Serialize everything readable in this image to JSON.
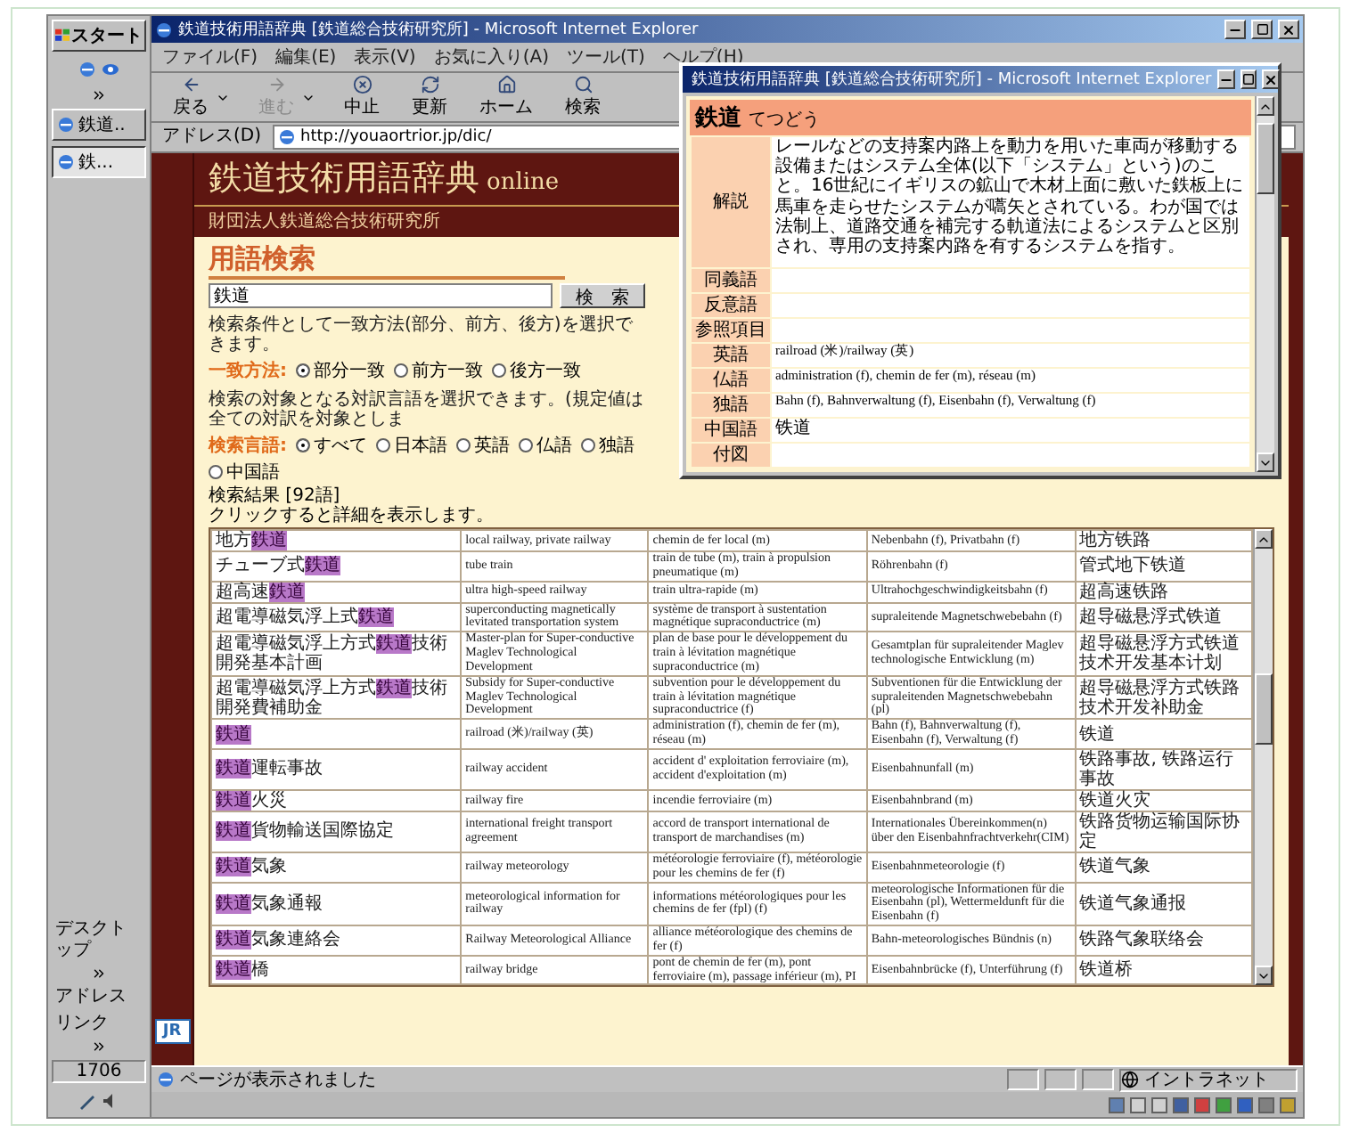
{
  "taskbar_left": {
    "start": "スタート",
    "buttons": [
      {
        "label": "鉄道..",
        "selected": false
      },
      {
        "label": "鉄...",
        "selected": true
      }
    ],
    "toolbars": [
      "デスクトップ",
      "アドレス",
      "リンク"
    ],
    "clock": "1706"
  },
  "window": {
    "title": "鉄道技術用語辞典 [鉄道総合技術研究所] - Microsoft Internet Explorer"
  },
  "menu": [
    "ファイル(F)",
    "編集(E)",
    "表示(V)",
    "お気に入り(A)",
    "ツール(T)",
    "ヘルプ(H)"
  ],
  "toolbar": [
    {
      "label": "戻る",
      "disabled": false,
      "dropdown": true
    },
    {
      "label": "進む",
      "disabled": true,
      "dropdown": true
    },
    {
      "label": "中止",
      "disabled": false,
      "dropdown": false
    },
    {
      "label": "更新",
      "disabled": false,
      "dropdown": false
    },
    {
      "label": "ホーム",
      "disabled": false,
      "dropdown": false
    },
    {
      "label": "検索",
      "disabled": false,
      "dropdown": false
    }
  ],
  "address": {
    "label": "アドレス(D)",
    "url": "http://youaortrior.jp/dic/"
  },
  "page": {
    "title": "鉄道技術用語辞典",
    "title_suffix": "online",
    "org": "財団法人鉄道総合技術研究所",
    "logo": "JR",
    "heading": "用語検索",
    "search": {
      "value": "鉄道",
      "button": "検　索"
    },
    "filters": [
      {
        "note": "検索条件として一致方法(部分、前方、後方)を選択できます。",
        "label": "一致方法:",
        "options": [
          {
            "label": "部分一致",
            "selected": true
          },
          {
            "label": "前方一致",
            "selected": false
          },
          {
            "label": "後方一致",
            "selected": false
          }
        ]
      },
      {
        "note": "検索の対象となる対訳言語を選択できます。(規定値は全ての対訳を対象としま",
        "label": "検索言語:",
        "options": [
          {
            "label": "すべて",
            "selected": true
          },
          {
            "label": "日本語",
            "selected": false
          },
          {
            "label": "英語",
            "selected": false
          },
          {
            "label": "仏語",
            "selected": false
          },
          {
            "label": "独語",
            "selected": false
          },
          {
            "label": "中国語",
            "selected": false
          }
        ]
      }
    ],
    "results": {
      "count": "検索結果 [92語]",
      "hint": "クリックすると詳細を表示します。",
      "rows": [
        {
          "term": [
            {
              "text": "地方",
              "hit": false
            },
            {
              "text": "鉄道",
              "hit": true
            }
          ],
          "en": "local railway, private railway",
          "fr": "chemin de fer local (m)",
          "de": "Nebenbahn (f), Privatbahn (f)",
          "zh": "地方铁路"
        },
        {
          "term": [
            {
              "text": "チューブ式",
              "hit": false
            },
            {
              "text": "鉄道",
              "hit": true
            }
          ],
          "en": "tube train",
          "fr": "train de tube (m), train à propulsion pneumatique (m)",
          "de": "Röhrenbahn (f)",
          "zh": "管式地下铁道"
        },
        {
          "term": [
            {
              "text": "超高速",
              "hit": false
            },
            {
              "text": "鉄道",
              "hit": true
            }
          ],
          "en": "ultra high-speed railway",
          "fr": "train ultra-rapide (m)",
          "de": "Ultrahochgeschwindigkeitsbahn (f)",
          "zh": "超高速铁路"
        },
        {
          "term": [
            {
              "text": "超電導磁気浮上式",
              "hit": false
            },
            {
              "text": "鉄道",
              "hit": true
            }
          ],
          "en": "superconducting magnetically levitated transportation system",
          "fr": "système de transport à sustentation magnétique supraconductrice (m)",
          "de": "supraleitende Magnetschwebebahn (f)",
          "zh": "超导磁悬浮式铁道"
        },
        {
          "term": [
            {
              "text": "超電導磁気浮上方式",
              "hit": false
            },
            {
              "text": "鉄道",
              "hit": true
            },
            {
              "text": "技術開発基本計画",
              "hit": false
            }
          ],
          "en": "Master-plan for Super-conductive Maglev Technological Development",
          "fr": "plan de base pour le développement du train à lévitation magnétique supraconductrice (m)",
          "de": "Gesamtplan für supraleitender Maglev technologische Entwicklung (m)",
          "zh": "超导磁悬浮方式铁道技术开发基本计划"
        },
        {
          "term": [
            {
              "text": "超電導磁気浮上方式",
              "hit": false
            },
            {
              "text": "鉄道",
              "hit": true
            },
            {
              "text": "技術開発費補助金",
              "hit": false
            }
          ],
          "en": "Subsidy for Super-conductive Maglev Technological Development",
          "fr": "subvention pour le développement du train à lévitation magnétique supraconductrice (f)",
          "de": "Subventionen für die Entwicklung der supraleitenden Magnetschwebebahn (pl)",
          "zh": "超导磁悬浮方式铁路技术开发补助金"
        },
        {
          "term": [
            {
              "text": "鉄道",
              "hit": true
            }
          ],
          "en": "railroad (米)/railway (英)",
          "fr": "administration (f), chemin de fer (m), réseau (m)",
          "de": "Bahn (f), Bahnverwaltung (f), Eisenbahn (f), Verwaltung (f)",
          "zh": "铁道"
        },
        {
          "term": [
            {
              "text": "鉄道",
              "hit": true
            },
            {
              "text": "運転事故",
              "hit": false
            }
          ],
          "en": "railway accident",
          "fr": "accident d' exploitation ferroviaire (m), accident d'exploitation (m)",
          "de": "Eisenbahnunfall (m)",
          "zh": "铁路事故, 铁路运行事故"
        },
        {
          "term": [
            {
              "text": "鉄道",
              "hit": true
            },
            {
              "text": "火災",
              "hit": false
            }
          ],
          "en": "railway fire",
          "fr": "incendie ferroviaire (m)",
          "de": "Eisenbahnbrand (m)",
          "zh": "铁道火灾"
        },
        {
          "term": [
            {
              "text": "鉄道",
              "hit": true
            },
            {
              "text": "貨物輸送国際協定",
              "hit": false
            }
          ],
          "en": "international freight transport agreement",
          "fr": "accord de transport international de transport de marchandises (m)",
          "de": "Internationales Übereinkommen(n) über den Eisenbahnfrachtverkehr(CIM)",
          "zh": "铁路货物运输国际协定"
        },
        {
          "term": [
            {
              "text": "鉄道",
              "hit": true
            },
            {
              "text": "気象",
              "hit": false
            }
          ],
          "en": "railway meteorology",
          "fr": "météorologie ferroviaire (f), météorologie pour les chemins de fer (f)",
          "de": "Eisenbahnmeteorologie (f)",
          "zh": "铁道气象"
        },
        {
          "term": [
            {
              "text": "鉄道",
              "hit": true
            },
            {
              "text": "気象通報",
              "hit": false
            }
          ],
          "en": "meteorological information for railway",
          "fr": "informations météorologiques pour les chemins de fer (fpl) (f)",
          "de": "meteorologische Informationen für die Eisenbahn (pl), Wettermeldunft für die Eisenbahn (f)",
          "zh": "铁道气象通报"
        },
        {
          "term": [
            {
              "text": "鉄道",
              "hit": true
            },
            {
              "text": "気象連絡会",
              "hit": false
            }
          ],
          "en": "Railway Meteorological Alliance",
          "fr": "alliance météorologique des chemins de fer (f)",
          "de": "Bahn-meteorologisches Bündnis (n)",
          "zh": "铁路气象联络会"
        },
        {
          "term": [
            {
              "text": "鉄道",
              "hit": true
            },
            {
              "text": "橋",
              "hit": false
            }
          ],
          "en": "railway bridge",
          "fr": "pont de chemin de fer (m), pont ferroviaire (m), passage inférieur (m), PI",
          "de": "Eisenbahnbrücke (f), Unterführung (f)",
          "zh": "铁道桥"
        }
      ]
    }
  },
  "status_bar": {
    "text": "ページが表示されました",
    "zone": "イントラネット"
  },
  "popup": {
    "title": "鉄道技術用語辞典 [鉄道総合技術研究所] - Microsoft Internet Explorer",
    "term": "鉄道",
    "reading": "てつどう",
    "rows": [
      {
        "label": "解説",
        "value": "レールなどの支持案内路上を動力を用いた車両が移動する設備またはシステム全体(以下「システム」という)のこと。16世紀にイギリスの鉱山で木材上面に敷いた鉄板上に馬車を走らせたシステムが嚆矢とされている。わが国では法制上、道路交通を補完する軌道法によるシステムと区別され、専用の支持案内路を有するシステムを指す。",
        "kind": "long"
      },
      {
        "label": "同義語"
      },
      {
        "label": "反意語"
      },
      {
        "label": "参照項目"
      },
      {
        "label": "英語",
        "value": "railroad (米)/railway (英)",
        "kind": "latin"
      },
      {
        "label": "仏語",
        "value": "administration (f), chemin de fer (m), réseau (m)",
        "kind": "latin"
      },
      {
        "label": "独語",
        "value": "Bahn (f), Bahnverwaltung (f), Eisenbahn (f), Verwaltung (f)",
        "kind": "latin"
      },
      {
        "label": "中国語",
        "value": "铁道",
        "kind": "cjk"
      },
      {
        "label": "付図"
      }
    ]
  }
}
